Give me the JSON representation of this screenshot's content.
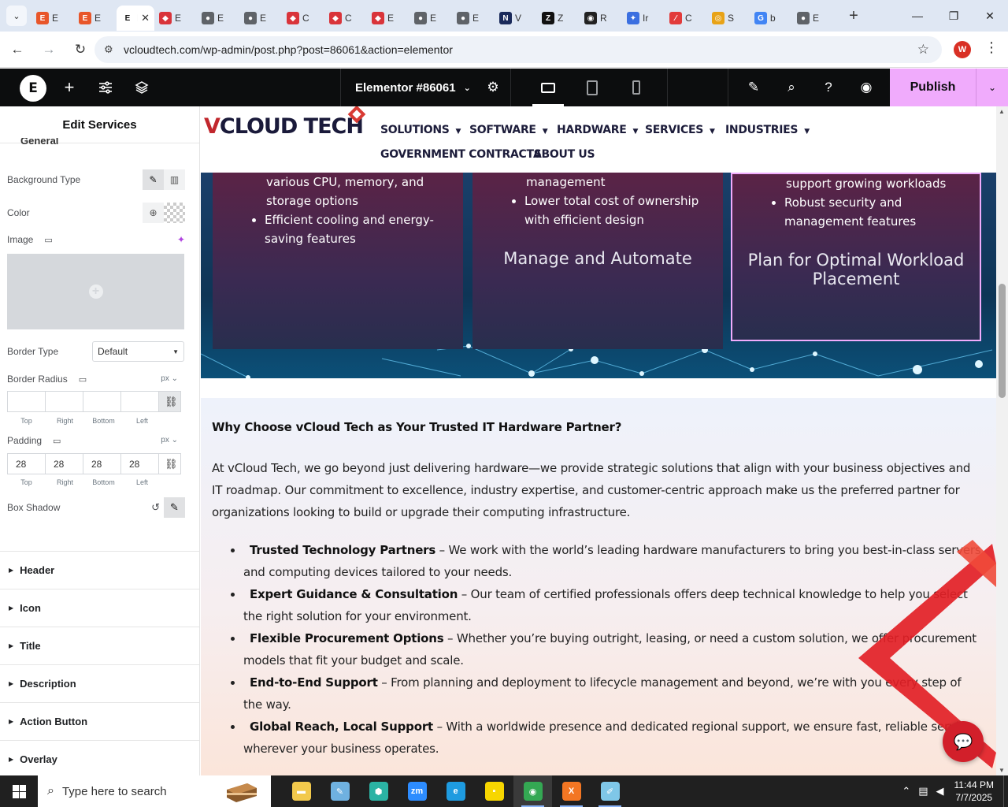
{
  "browser": {
    "tabs": [
      {
        "label": "E",
        "favicon": "E",
        "color": "#e8562a"
      },
      {
        "label": "E",
        "favicon": "E",
        "color": "#e8562a"
      },
      {
        "label": "E",
        "favicon": "E",
        "color": "#ffffff",
        "active": true
      },
      {
        "label": "E",
        "favicon": "◆",
        "color": "#d9343a"
      },
      {
        "label": "E",
        "favicon": "●",
        "color": "#5f6368"
      },
      {
        "label": "E",
        "favicon": "●",
        "color": "#5f6368"
      },
      {
        "label": "C",
        "favicon": "◆",
        "color": "#d9343a"
      },
      {
        "label": "C",
        "favicon": "◆",
        "color": "#d9343a"
      },
      {
        "label": "E",
        "favicon": "◆",
        "color": "#d9343a"
      },
      {
        "label": "E",
        "favicon": "●",
        "color": "#5f6368"
      },
      {
        "label": "E",
        "favicon": "●",
        "color": "#5f6368"
      },
      {
        "label": "V",
        "favicon": "N",
        "color": "#1a2a5a"
      },
      {
        "label": "Z",
        "favicon": "Z",
        "color": "#111111"
      },
      {
        "label": "R",
        "favicon": "◉",
        "color": "#222222"
      },
      {
        "label": "Ir",
        "favicon": "✦",
        "color": "#3b6fe0"
      },
      {
        "label": "C",
        "favicon": "∕",
        "color": "#e23b3b"
      },
      {
        "label": "S",
        "favicon": "◎",
        "color": "#e8a317"
      },
      {
        "label": "b",
        "favicon": "G",
        "color": "#4285f4"
      },
      {
        "label": "E",
        "favicon": "●",
        "color": "#5f6368"
      }
    ],
    "tab_close": "✕",
    "new_tab": "+",
    "window_controls": {
      "minimize": "—",
      "maximize": "❐",
      "close": "✕"
    },
    "url": "vcloudtech.com/wp-admin/post.php?post=86061&action=elementor",
    "profile_initial": "W"
  },
  "elementor": {
    "logo": "E",
    "document_title": "Elementor #86061",
    "publish_label": "Publish",
    "icons": [
      "add-icon",
      "settings-sliders-icon",
      "layers-icon",
      "gear-icon",
      "desktop-icon",
      "tablet-icon",
      "mobile-icon",
      "notes-icon",
      "search-icon",
      "help-icon",
      "preview-eye-icon"
    ]
  },
  "panel": {
    "title": "Edit Services",
    "section_cut": "General",
    "background_type_label": "Background Type",
    "color_label": "Color",
    "image_label": "Image",
    "border_type_label": "Border Type",
    "border_type_value": "Default",
    "border_radius_label": "Border Radius",
    "unit": "px",
    "dim_labels": [
      "Top",
      "Right",
      "Bottom",
      "Left"
    ],
    "border_radius_values": [
      "",
      "",
      "",
      ""
    ],
    "padding_label": "Padding",
    "padding_values": [
      "28",
      "28",
      "28",
      "28"
    ],
    "box_shadow_label": "Box Shadow",
    "sections": [
      "Header",
      "Icon",
      "Title",
      "Description",
      "Action Button",
      "Overlay"
    ]
  },
  "site": {
    "brand_v": "V",
    "brand_rest": "CLOUD TECH",
    "menu": [
      {
        "label": "SOLUTIONS",
        "dropdown": true
      },
      {
        "label": "SOFTWARE",
        "dropdown": true
      },
      {
        "label": "HARDWARE",
        "dropdown": true
      },
      {
        "label": "SERVICES",
        "dropdown": true
      },
      {
        "label": "INDUSTRIES",
        "dropdown": true
      },
      {
        "label": "GOVERNMENT CONTRACTS",
        "dropdown": false
      },
      {
        "label": "ABOUT US",
        "dropdown": false
      }
    ]
  },
  "cards": [
    {
      "line_top": "various CPU, memory, and",
      "bullets": [
        "storage options",
        "Efficient cooling and energy-saving features"
      ],
      "title": ""
    },
    {
      "line_top": "management",
      "bullets": [
        "Lower total cost of ownership with efficient design"
      ],
      "title": "Manage and Automate"
    },
    {
      "line_top": "support growing workloads",
      "bullets": [
        "Robust security and management features"
      ],
      "title": "Plan for Optimal Workload Placement"
    }
  ],
  "why": {
    "heading": "Why Choose vCloud Tech as Your Trusted IT Hardware Partner?",
    "intro": "At vCloud Tech, we go beyond just delivering hardware—we provide strategic solutions that align with your business objectives and IT roadmap. Our commitment to excellence, industry expertise, and customer-centric approach make us the preferred partner for organizations looking to build or upgrade their computing infrastructure.",
    "items": [
      {
        "title": "Trusted Technology Partners",
        "text": " – We work with the world’s leading hardware manufacturers to bring you best-in-class servers and computing devices tailored to your needs."
      },
      {
        "title": "Expert Guidance & Consultation",
        "text": " – Our team of certified professionals offers deep technical knowledge to help you select the right solution for your environment."
      },
      {
        "title": "Flexible Procurement Options",
        "text": " – Whether you’re buying outright, leasing, or need a custom solution, we offer procurement models that fit your budget and scale."
      },
      {
        "title": "End-to-End Support",
        "text": " – From planning and deployment to lifecycle management and beyond, we’re with you every step of the way."
      },
      {
        "title": "Global Reach, Local Support",
        "text": " – With a worldwide presence and dedicated regional support, we ensure fast, reliable service wherever your business operates."
      }
    ]
  },
  "taskbar": {
    "search_placeholder": "Type here to search",
    "apps": [
      {
        "name": "file-explorer-icon",
        "glyph": "▬",
        "color": "#f2c94c"
      },
      {
        "name": "paint-icon",
        "glyph": "✎",
        "color": "#6fb1e0"
      },
      {
        "name": "app-hex-icon",
        "glyph": "⬢",
        "color": "#2bb3a4"
      },
      {
        "name": "zoom-icon",
        "glyph": "zm",
        "color": "#2d8cff"
      },
      {
        "name": "edge-icon",
        "glyph": "e",
        "color": "#1e9be0"
      },
      {
        "name": "sticky-notes-icon",
        "glyph": "▪",
        "color": "#f7d600"
      },
      {
        "name": "chrome-icon",
        "glyph": "◉",
        "color": "#34a853"
      },
      {
        "name": "xampp-icon",
        "glyph": "X",
        "color": "#f37623"
      },
      {
        "name": "notepad-icon",
        "glyph": "✐",
        "color": "#7fc7e8"
      }
    ],
    "time": "11:44 PM",
    "date": "7/7/2025"
  }
}
